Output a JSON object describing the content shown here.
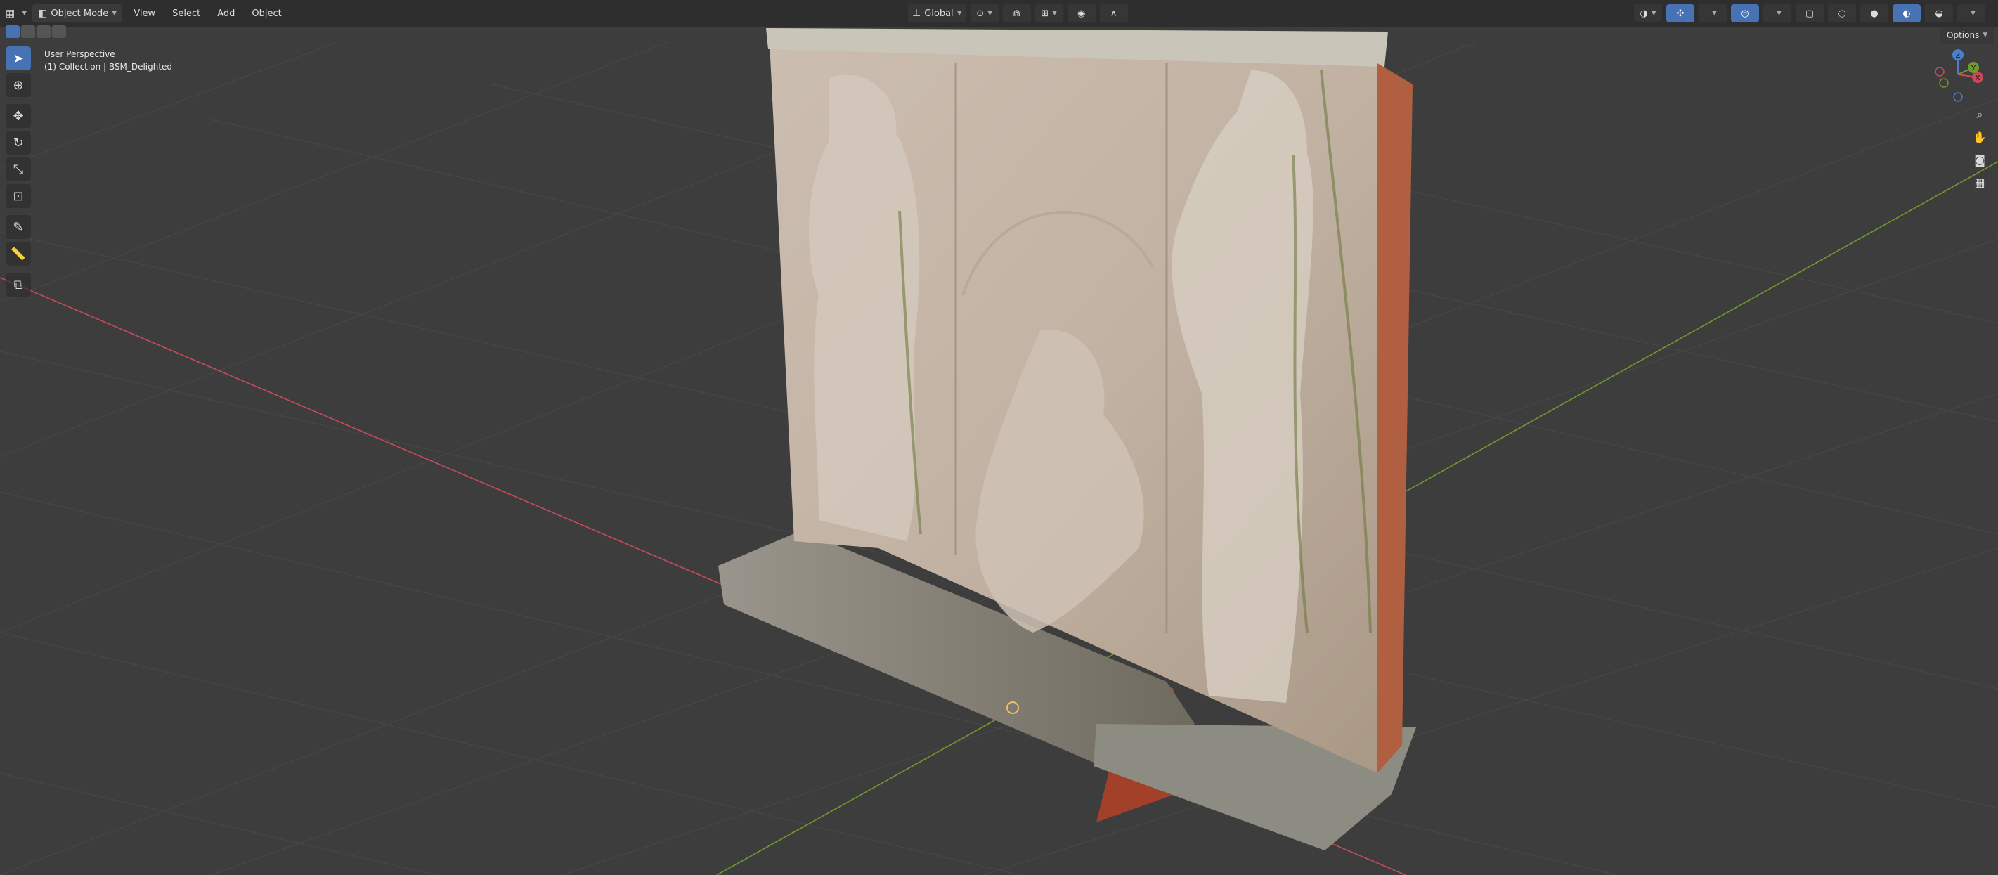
{
  "header": {
    "editor_icon": "viewport-icon",
    "mode": "Object Mode",
    "menus": [
      "View",
      "Select",
      "Add",
      "Object"
    ],
    "transform_orientation": "Global"
  },
  "viewport": {
    "perspective_label": "User Perspective",
    "collection_label": "(1) Collection | BSM_Delighted"
  },
  "options_label": "Options",
  "gizmo": {
    "x": "X",
    "y": "Y",
    "z": "Z"
  },
  "toolbar": {
    "tools": [
      {
        "name": "select-box",
        "icon": "cursor-arrow-icon"
      },
      {
        "name": "cursor",
        "icon": "3d-cursor-icon"
      },
      {
        "name": "move",
        "icon": "move-arrows-icon"
      },
      {
        "name": "rotate",
        "icon": "rotate-icon"
      },
      {
        "name": "scale",
        "icon": "scale-icon"
      },
      {
        "name": "transform",
        "icon": "transform-icon"
      },
      {
        "name": "annotate",
        "icon": "pencil-icon"
      },
      {
        "name": "measure",
        "icon": "ruler-icon"
      },
      {
        "name": "add-cube",
        "icon": "add-cube-icon"
      }
    ]
  },
  "colors": {
    "viewport_bg": "#3d3d3d",
    "grid": "#4a4a4a",
    "x_axis": "#c84a5a",
    "y_axis": "#6f9a2c",
    "active_tool": "#4772b3"
  }
}
